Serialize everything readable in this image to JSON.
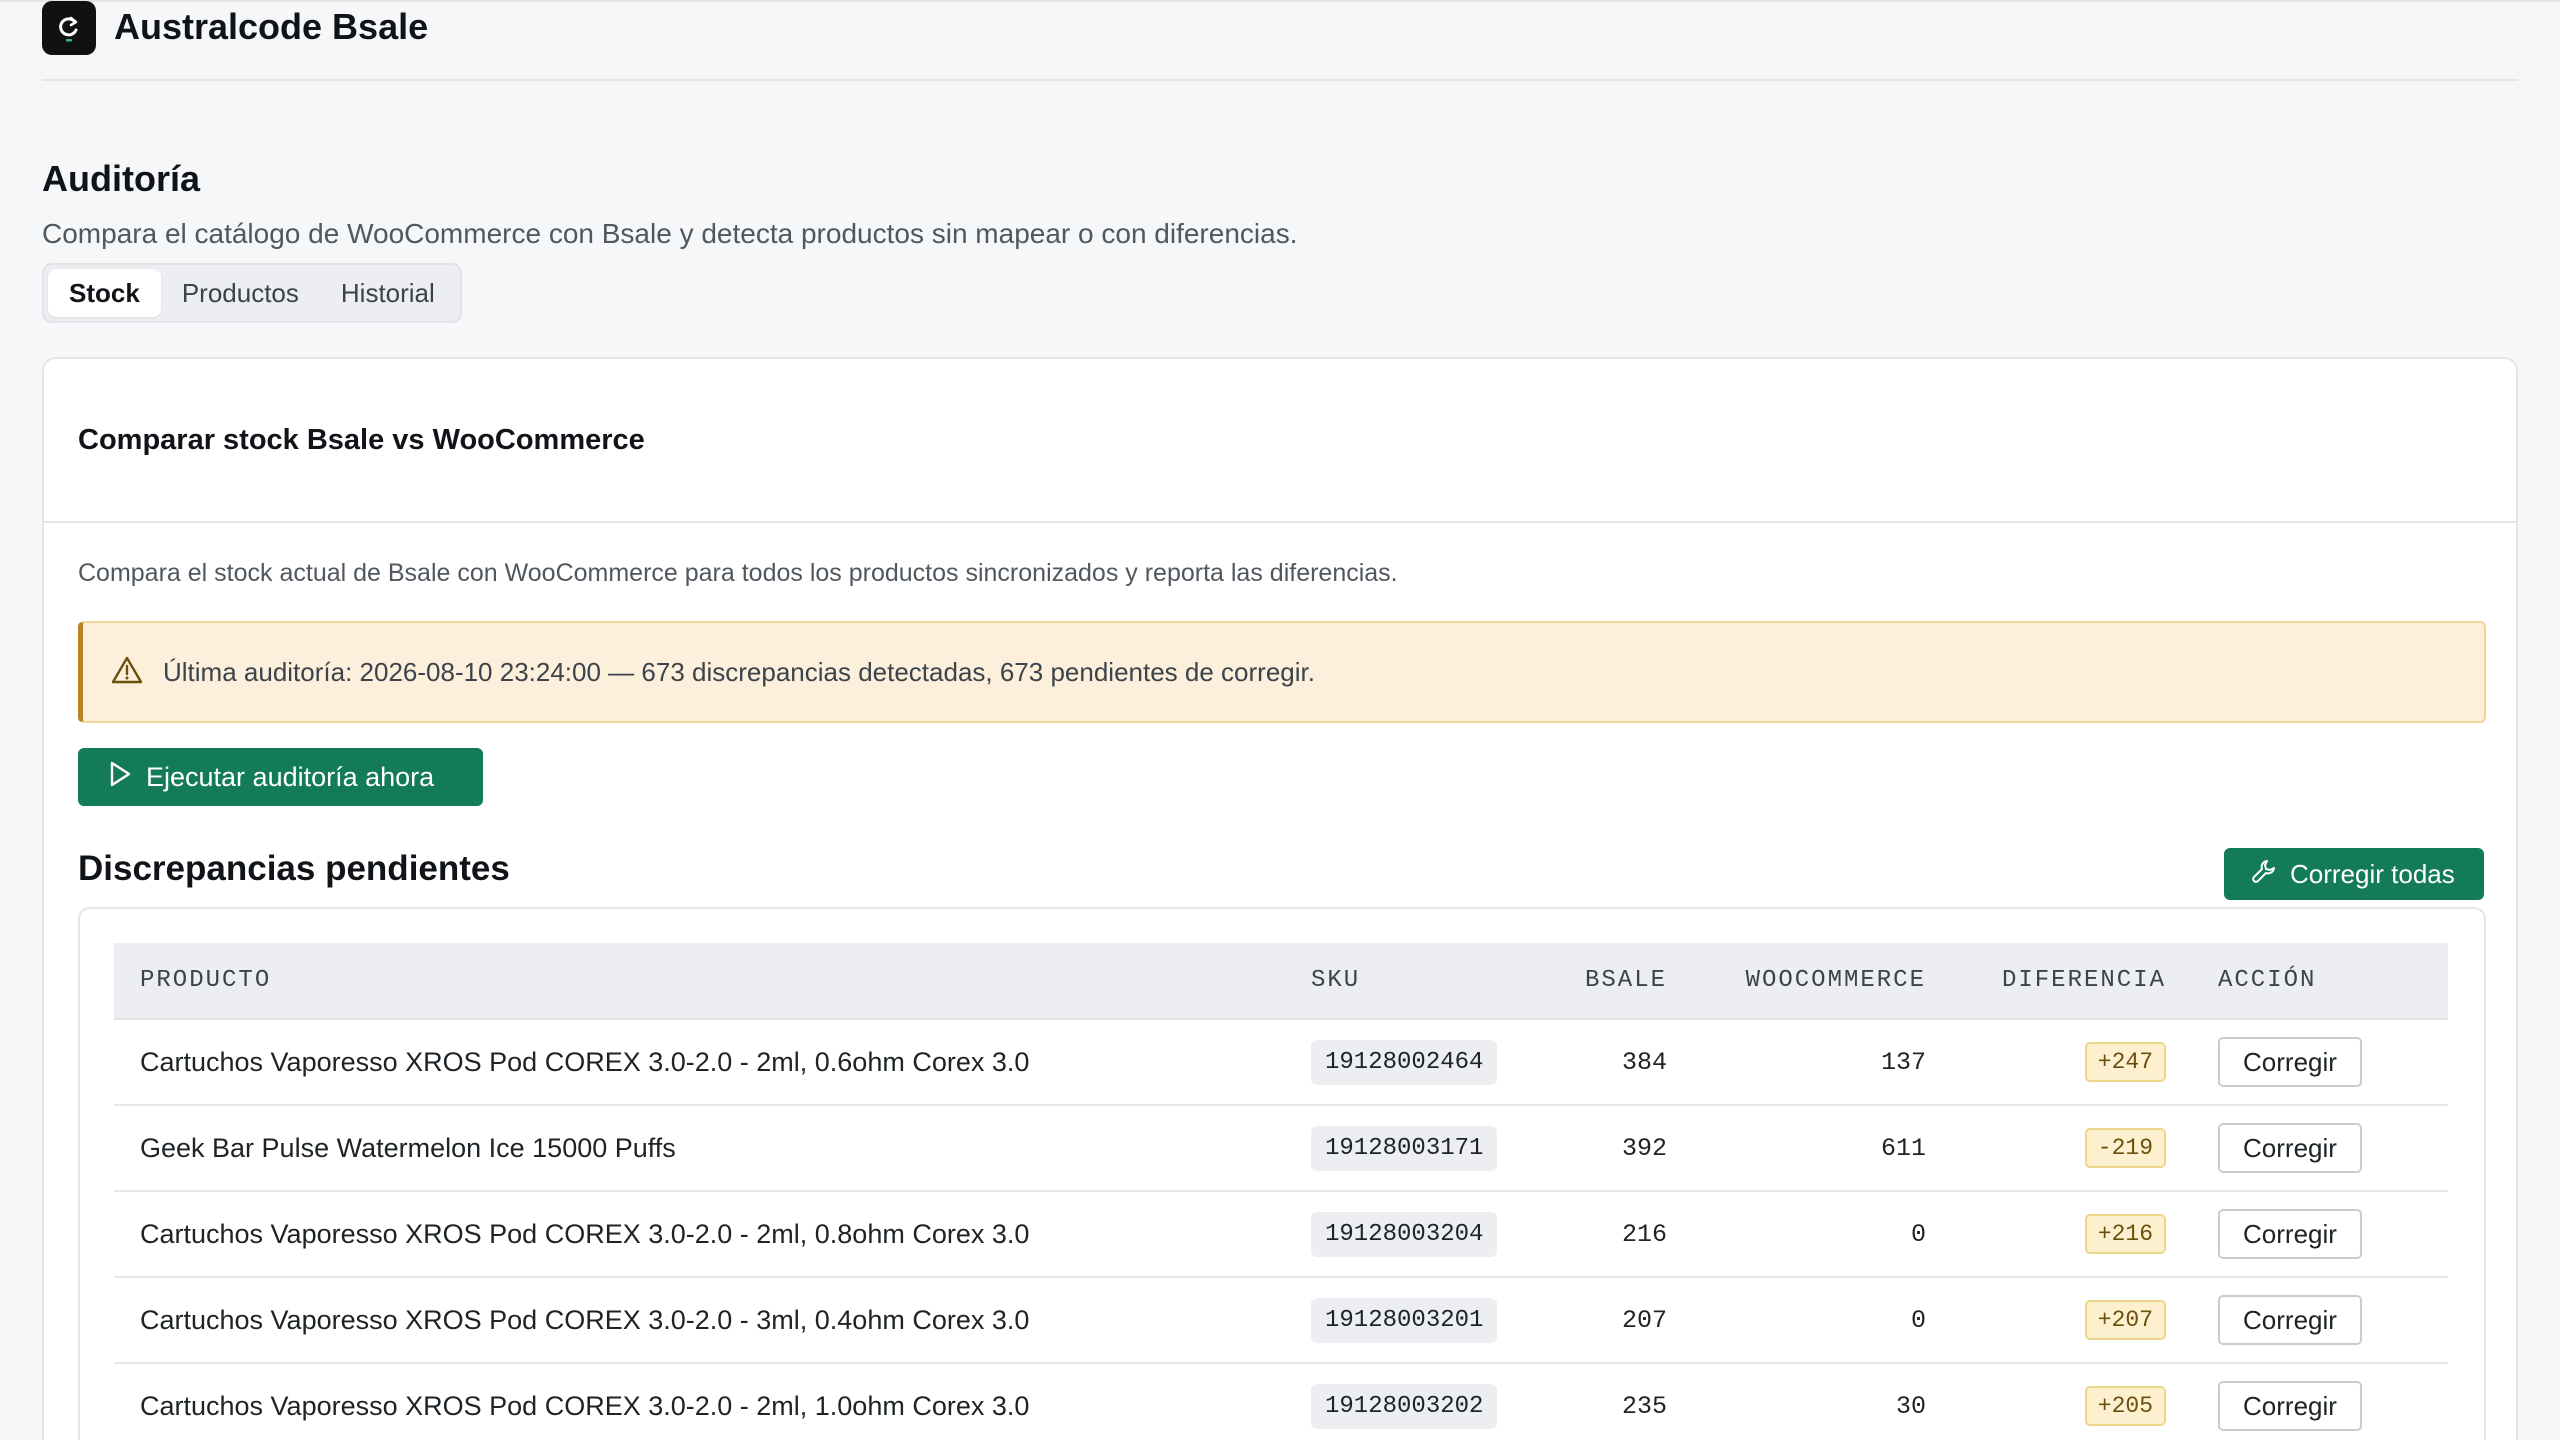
{
  "app": {
    "title": "Australcode Bsale"
  },
  "page": {
    "title": "Auditoría",
    "description": "Compara el catálogo de WooCommerce con Bsale y detecta productos sin mapear o con diferencias.",
    "tabs": [
      {
        "label": "Stock",
        "active": true
      },
      {
        "label": "Productos",
        "active": false
      },
      {
        "label": "Historial",
        "active": false
      }
    ]
  },
  "card": {
    "title": "Comparar stock Bsale vs WooCommerce",
    "description": "Compara el stock actual de Bsale con WooCommerce para todos los productos sincronizados y reporta las diferencias.",
    "notice": "Última auditoría: 2026-08-10 23:24:00 — 673 discrepancias detectadas, 673 pendientes de corregir.",
    "run_button": "Ejecutar auditoría ahora"
  },
  "discrepancies": {
    "title": "Discrepancias pendientes",
    "fix_all_button": "Corregir todas",
    "columns": [
      "PRODUCTO",
      "SKU",
      "BSALE",
      "WOOCOMMERCE",
      "DIFERENCIA",
      "ACCIÓN"
    ],
    "action_label": "Corregir",
    "rows": [
      {
        "product": "Cartuchos Vaporesso XROS Pod COREX 3.0-2.0 - 2ml, 0.6ohm Corex 3.0",
        "sku": "19128002464",
        "bsale": "384",
        "woo": "137",
        "diff": "+247"
      },
      {
        "product": "Geek Bar Pulse Watermelon Ice 15000 Puffs",
        "sku": "19128003171",
        "bsale": "392",
        "woo": "611",
        "diff": "-219"
      },
      {
        "product": "Cartuchos Vaporesso XROS Pod COREX 3.0-2.0 - 2ml, 0.8ohm Corex 3.0",
        "sku": "19128003204",
        "bsale": "216",
        "woo": "0",
        "diff": "+216"
      },
      {
        "product": "Cartuchos Vaporesso XROS Pod COREX 3.0-2.0 - 3ml, 0.4ohm Corex 3.0",
        "sku": "19128003201",
        "bsale": "207",
        "woo": "0",
        "diff": "+207"
      },
      {
        "product": "Cartuchos Vaporesso XROS Pod COREX 3.0-2.0 - 2ml, 1.0ohm Corex 3.0",
        "sku": "19128003202",
        "bsale": "235",
        "woo": "30",
        "diff": "+205"
      }
    ]
  },
  "colors": {
    "primary": "#137a5a",
    "warning_bg": "#fcf0dc",
    "warning_border": "#b7821f"
  },
  "icons": {
    "logo": "refresh-logo-icon",
    "warning": "warning-triangle-icon",
    "run": "play-icon",
    "fix_all": "wrench-icon"
  }
}
